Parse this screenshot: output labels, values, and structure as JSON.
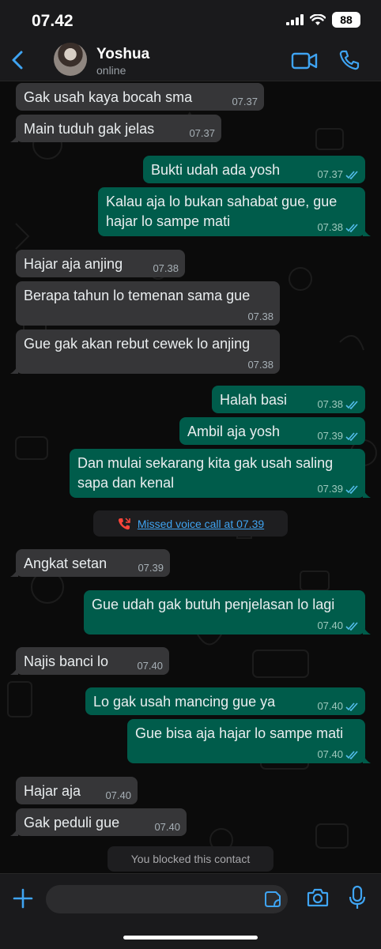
{
  "status_bar": {
    "time": "07.42",
    "battery": "88"
  },
  "header": {
    "contact_name": "Yoshua",
    "contact_status": "online"
  },
  "messages": [
    {
      "dir": "in",
      "text": "Gak usah kaya bocah sma",
      "time": "07.37"
    },
    {
      "dir": "in",
      "text": "Main tuduh gak jelas",
      "time": "07.37"
    },
    {
      "dir": "out",
      "text": "Bukti udah ada yosh",
      "time": "07.37",
      "read": true
    },
    {
      "dir": "out",
      "text": "Kalau aja lo bukan sahabat gue, gue\nhajar lo sampe mati",
      "time": "07.38",
      "read": true
    },
    {
      "dir": "in",
      "text": "Hajar aja anjing",
      "time": "07.38"
    },
    {
      "dir": "in",
      "text": "Berapa tahun lo temenan sama gue",
      "time": "07.38"
    },
    {
      "dir": "in",
      "text": "Gue gak akan rebut cewek lo anjing",
      "time": "07.38"
    },
    {
      "dir": "out",
      "text": "Halah basi",
      "time": "07.38",
      "read": true
    },
    {
      "dir": "out",
      "text": "Ambil aja yosh",
      "time": "07.39",
      "read": true
    },
    {
      "dir": "out",
      "text": "Dan mulai sekarang kita gak usah saling\nsapa dan kenal",
      "time": "07.39",
      "read": true
    },
    {
      "dir": "in",
      "text": "Angkat setan",
      "time": "07.39"
    },
    {
      "dir": "out",
      "text": "Gue udah gak butuh penjelasan lo lagi",
      "time": "07.40",
      "read": true
    },
    {
      "dir": "in",
      "text": "Najis banci lo",
      "time": "07.40"
    },
    {
      "dir": "out",
      "text": "Lo gak usah mancing gue ya",
      "time": "07.40",
      "read": true
    },
    {
      "dir": "out",
      "text": "Gue bisa aja hajar lo sampe mati",
      "time": "07.40",
      "read": true
    },
    {
      "dir": "in",
      "text": "Hajar aja",
      "time": "07.40"
    },
    {
      "dir": "in",
      "text": "Gak peduli gue",
      "time": "07.40"
    }
  ],
  "missed_call": {
    "text": "Missed voice call at 07.39"
  },
  "blocked_notice": {
    "text": "You blocked this contact"
  },
  "composer": {
    "placeholder": ""
  },
  "colors": {
    "incoming_bubble": "#363638",
    "outgoing_bubble": "#005c4b",
    "accent": "#3fa4f2",
    "missed_call_icon": "#ff453a"
  }
}
